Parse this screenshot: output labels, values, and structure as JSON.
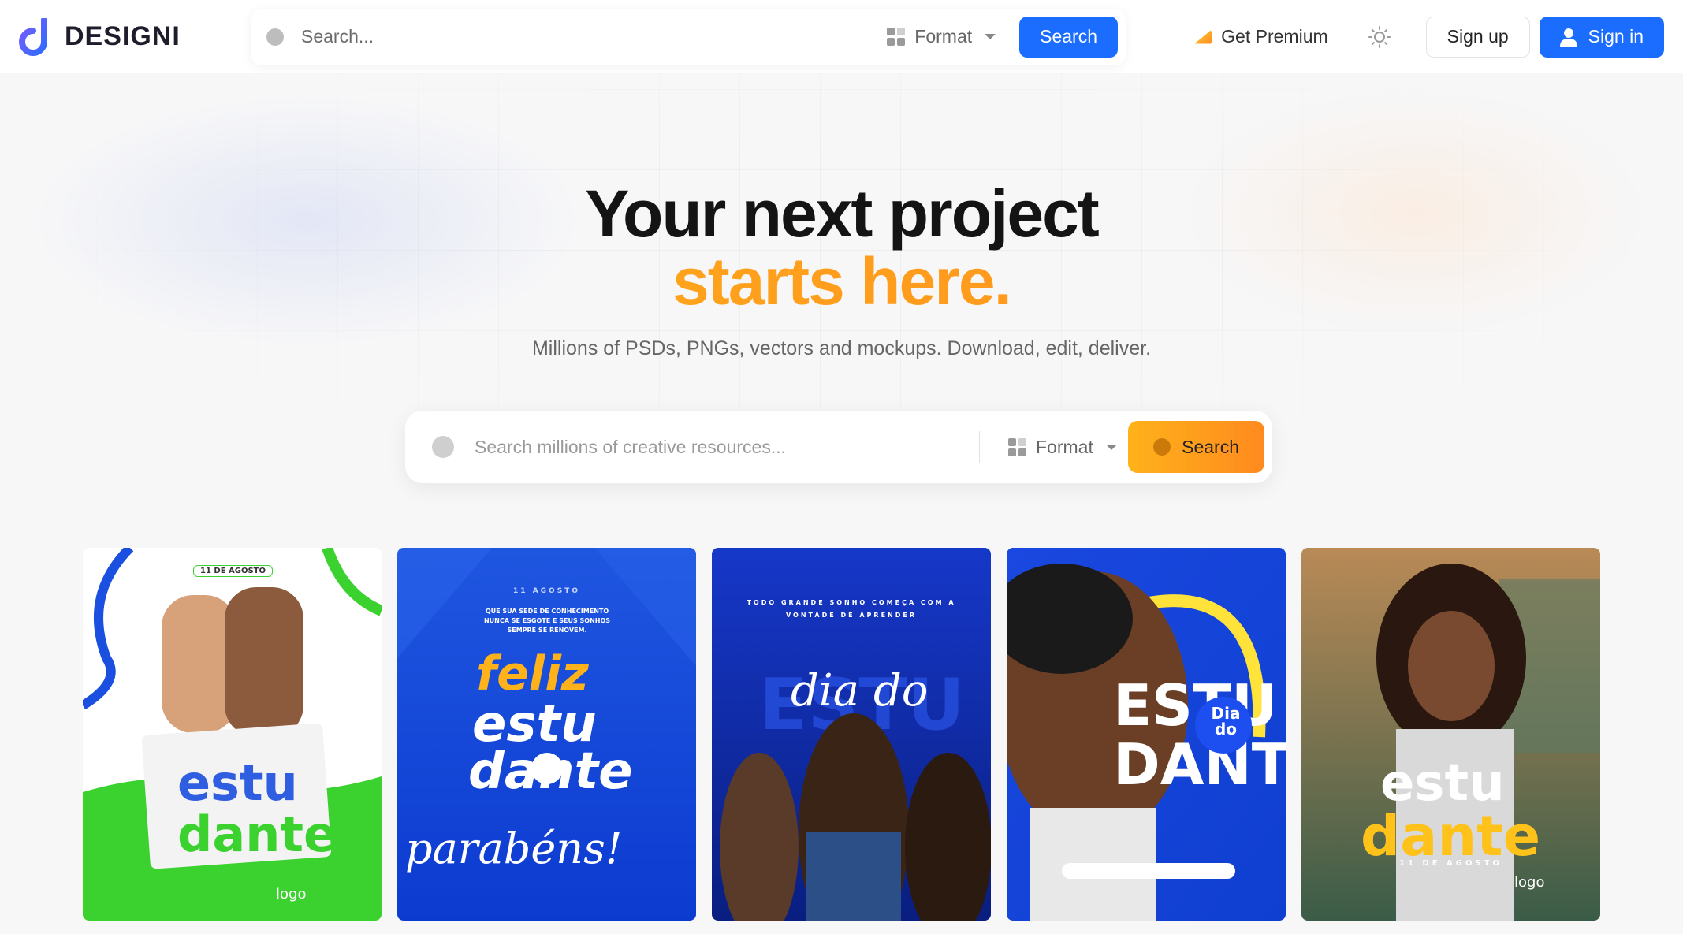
{
  "header": {
    "logo_text": "DESIGNI",
    "search_placeholder": "Search...",
    "format_label": "Format",
    "search_button": "Search",
    "premium_label": "Get Premium",
    "signup_label": "Sign up",
    "signin_label": "Sign in"
  },
  "hero": {
    "title_line1": "Your next project",
    "title_line2": "starts here.",
    "subtitle": "Millions of PSDs, PNGs, vectors and mockups. Download, edit, deliver.",
    "search_placeholder": "Search millions of creative resources...",
    "format_label": "Format",
    "search_button": "Search"
  },
  "cards": [
    {
      "alt": "dia do estudante",
      "top_text": "11 DE AGOSTO",
      "logo": "logo"
    },
    {
      "alt": "feliz dia do estudante parabéns",
      "top_text": "11 AGOSTO",
      "tagline": "QUE SUA SEDE DE CONHECIMENTO NUNCA SE ESGOTE E SEUS SONHOS SEMPRE SE RENOVEM."
    },
    {
      "alt": "dia do estudante",
      "top_text": "TODO GRANDE SONHO COMEÇA COM A VONTADE DE APRENDER"
    },
    {
      "alt": "Dia do estudante",
      "badge": "Dia do"
    },
    {
      "alt": "Dia do estudante",
      "date": "11 DE AGOSTO",
      "logo": "logo"
    }
  ],
  "colors": {
    "accent_blue": "#1a6dff",
    "accent_orange": "#ff9a1a",
    "logo_purple": "#5b4bff"
  }
}
